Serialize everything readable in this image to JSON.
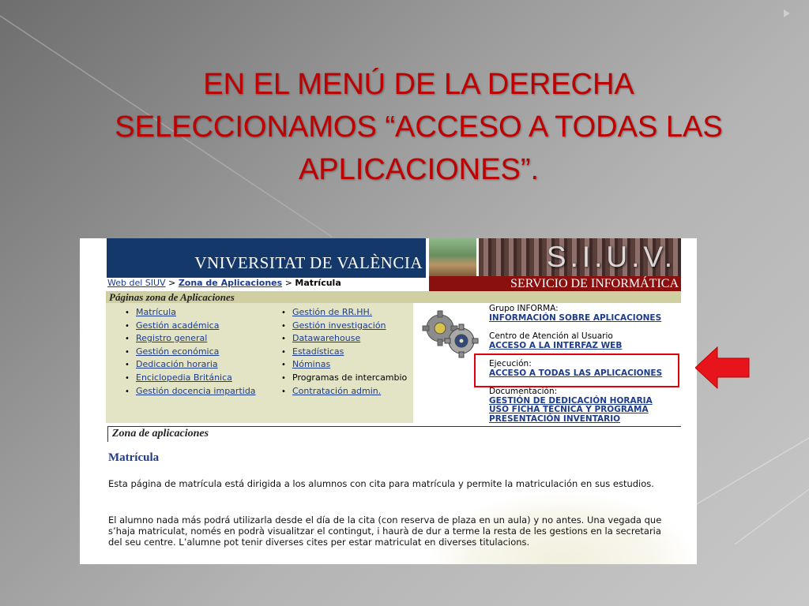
{
  "slide": {
    "title_lines": [
      "EN EL MENÚ DE LA DERECHA",
      "SELECCIONAMOS “ACCESO A TODAS LAS",
      "APLICACIONES”."
    ],
    "title_color": "#c00000",
    "arrow_color": "#e8141c"
  },
  "header": {
    "logo_text": "VNIVERSITAT DE VALÈNCIA",
    "siuv_text": "S.I.U.V.",
    "servicio_text": "SERVICIO DE INFORMÁTICA",
    "logo_bg": "#15386b",
    "servicio_bg": "#8a1010"
  },
  "breadcrumb": {
    "item1": "Web del SIUV",
    "sep1": " > ",
    "item2": "Zona de Aplicaciones",
    "sep2": " > ",
    "current": "Matrícula"
  },
  "apps_bar": {
    "title": "Páginas zona de Aplicaciones"
  },
  "apps_col1": [
    "Matrícula",
    "Gestión académica",
    "Registro general",
    "Gestión económica",
    "Dedicación horaria",
    "Enciclopedia Británica",
    "Gestión docencia impartida"
  ],
  "apps_col2": [
    "Gestión de RR.HH.",
    "Gestión investigación",
    "Datawarehouse",
    "Estadísticas",
    "Nóminas",
    "Programas de intercambio",
    "Contratación admin."
  ],
  "right_menu": {
    "g1_label": "Grupo INFORMA:",
    "g1_link": "INFORMACIÓN SOBRE APLICACIONES",
    "g2_label": "Centro de Atención al Usuario",
    "g2_link": "ACCESO A LA INTERFAZ WEB",
    "g3_label": "Ejecución:",
    "g3_link": "ACCESO A TODAS LAS APLICACIONES",
    "g4_label": "Documentación:",
    "g4_links": [
      "GESTIÓN DE DEDICACIÓN HORARIA",
      "USO FICHA TÉCNICA Y PROGRAMA",
      "PRESENTACIÓN INVENTARIO"
    ]
  },
  "content": {
    "zona_title": "Zona de aplicaciones",
    "heading": "Matrícula",
    "para1": "Esta página de matrícula está dirigida a los alumnos con cita para matrícula y permite la matriculación en sus estudios.",
    "para2": "El alumno nada más podrá utilizarla desde el día de la cita (con reserva de plaza en un aula) y no antes. Una vegada que s’haja matriculat, només en podrà visualitzar el contingut, i haurà de dur a terme la resta de les gestions en la secretaria del seu centre. L’alumne pot tenir diverses cites per estar matriculat en diverses titulacions."
  },
  "colors": {
    "link": "#1d3c8c",
    "bar": "#cfcfa2",
    "panel": "#e3e3c6",
    "highlight_box": "#e0000a"
  }
}
